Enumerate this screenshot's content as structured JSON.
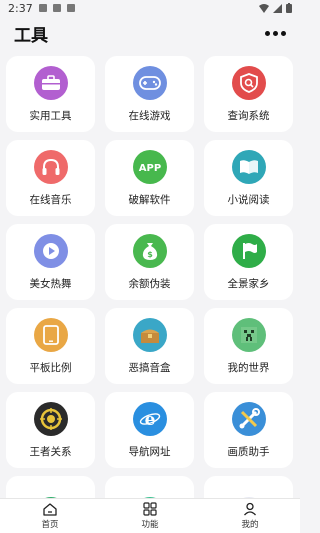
{
  "status": {
    "time": "2:37"
  },
  "header": {
    "title": "工具"
  },
  "tools": [
    {
      "label": "实用工具",
      "icon": "toolbox-icon",
      "color": "#b25fd0"
    },
    {
      "label": "在线游戏",
      "icon": "gamepad-icon",
      "color": "#6f8fe0"
    },
    {
      "label": "查询系统",
      "icon": "search-shield-icon",
      "color": "#e24c4c"
    },
    {
      "label": "在线音乐",
      "icon": "headphones-icon",
      "color": "#ef6a6a"
    },
    {
      "label": "破解软件",
      "icon": "app-icon",
      "color": "#47b84d"
    },
    {
      "label": "小说阅读",
      "icon": "book-icon",
      "color": "#2fa7b7"
    },
    {
      "label": "美女热舞",
      "icon": "play-icon",
      "color": "#7f8fe5"
    },
    {
      "label": "余额伪装",
      "icon": "money-bag-icon",
      "color": "#49b84f"
    },
    {
      "label": "全景家乡",
      "icon": "flag-icon",
      "color": "#2fad48"
    },
    {
      "label": "平板比例",
      "icon": "tablet-icon",
      "color": "#e9a745"
    },
    {
      "label": "恶搞音盒",
      "icon": "chest-icon",
      "color": "#3aa7c7"
    },
    {
      "label": "我的世界",
      "icon": "creeper-icon",
      "color": "#5fbf7a"
    },
    {
      "label": "王者关系",
      "icon": "target-icon",
      "color": "#2b2b2b"
    },
    {
      "label": "导航网址",
      "icon": "browser-icon",
      "color": "#2a8fe0"
    },
    {
      "label": "画质助手",
      "icon": "wrench-icon",
      "color": "#3a8fd8"
    }
  ],
  "tabbar": [
    {
      "label": "首页",
      "icon": "home-icon"
    },
    {
      "label": "功能",
      "icon": "grid-icon"
    },
    {
      "label": "我的",
      "icon": "user-icon"
    }
  ]
}
